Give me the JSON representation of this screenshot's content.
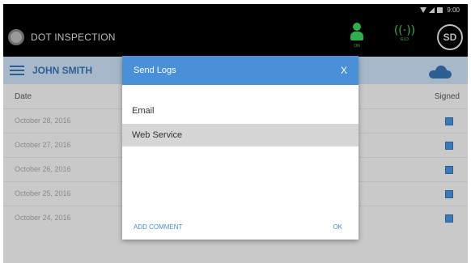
{
  "status_bar": {
    "time": "9:00"
  },
  "app_bar": {
    "title": "DOT INSPECTION",
    "driver_status_label": "ON",
    "signal_label": "ELD",
    "badge": "SD"
  },
  "toolbar": {
    "driver_name": "JOHN SMITH"
  },
  "logs": {
    "columns": {
      "date": "Date",
      "signed": "Signed"
    },
    "rows": [
      {
        "date": "October 28, 2016",
        "signed": true
      },
      {
        "date": "October 27, 2016",
        "signed": true
      },
      {
        "date": "October 26, 2016",
        "signed": true
      },
      {
        "date": "October 25, 2016",
        "signed": true
      },
      {
        "date": "October 24, 2016",
        "signed": true
      }
    ]
  },
  "dialog": {
    "title": "Send Logs",
    "close": "X",
    "options": [
      {
        "label": "Email",
        "selected": false
      },
      {
        "label": "Web Service",
        "selected": true
      }
    ],
    "add_comment": "ADD COMMENT",
    "ok": "OK"
  },
  "colors": {
    "dialog_header": "#4a90d9",
    "toolbar_text": "#2d5f93",
    "status_green": "#2fae4e",
    "checkbox": "#3b78b7"
  }
}
